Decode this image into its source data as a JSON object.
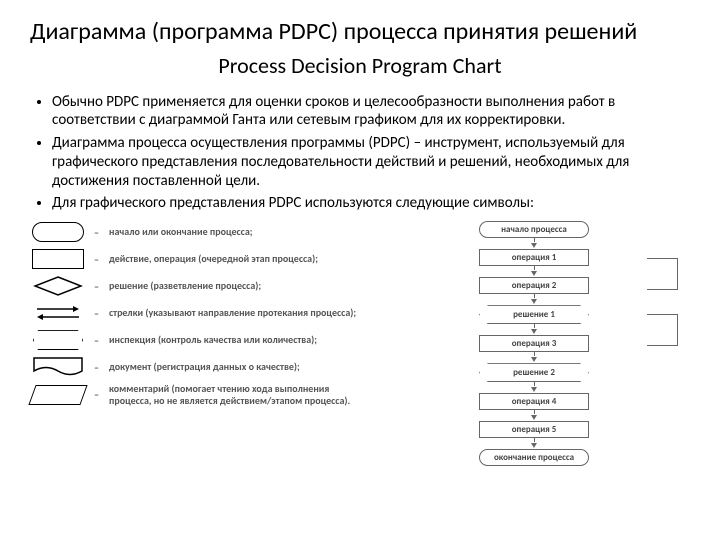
{
  "title": "Диаграмма (программа PDPC) процесса принятия решений",
  "subtitle": "Process Decision Program Chart",
  "bullets": [
    "Обычно PDPC применяется для оценки сроков и целесообразности выполнения работ в соответствии с диаграммой Ганта или сетевым графиком для их корректировки.",
    "Диаграмма процесса осуществления программы (PDPC) – инструмент, используемый для графического представления последовательности действий и решений, необходимых для достижения поставленной цели.",
    "Для графического представления PDPC используются следующие символы:"
  ],
  "legend": [
    {
      "sym": "round",
      "text": "начало или окончание процесса;"
    },
    {
      "sym": "rect",
      "text": "действие, операция (очередной этап процесса);"
    },
    {
      "sym": "diamond",
      "text": "решение (разветвление процесса);"
    },
    {
      "sym": "arrows",
      "text": "стрелки (указывают направление протекания процесса);"
    },
    {
      "sym": "hex",
      "text": "инспекция (контроль качества или количества);"
    },
    {
      "sym": "doc",
      "text": "документ (регистрация данных о качестве);"
    },
    {
      "sym": "para",
      "text": "комментарий (помогает чтению хода выполнения процесса, но не является действием/этапом процесса)."
    }
  ],
  "flow": {
    "start": "начало процесса",
    "op1": "операция 1",
    "op2": "операция 2",
    "dec1": "решение 1",
    "op3": "операция 3",
    "dec2": "решение 2",
    "op4": "операция 4",
    "op5": "операция 5",
    "end": "окончание процесса"
  }
}
